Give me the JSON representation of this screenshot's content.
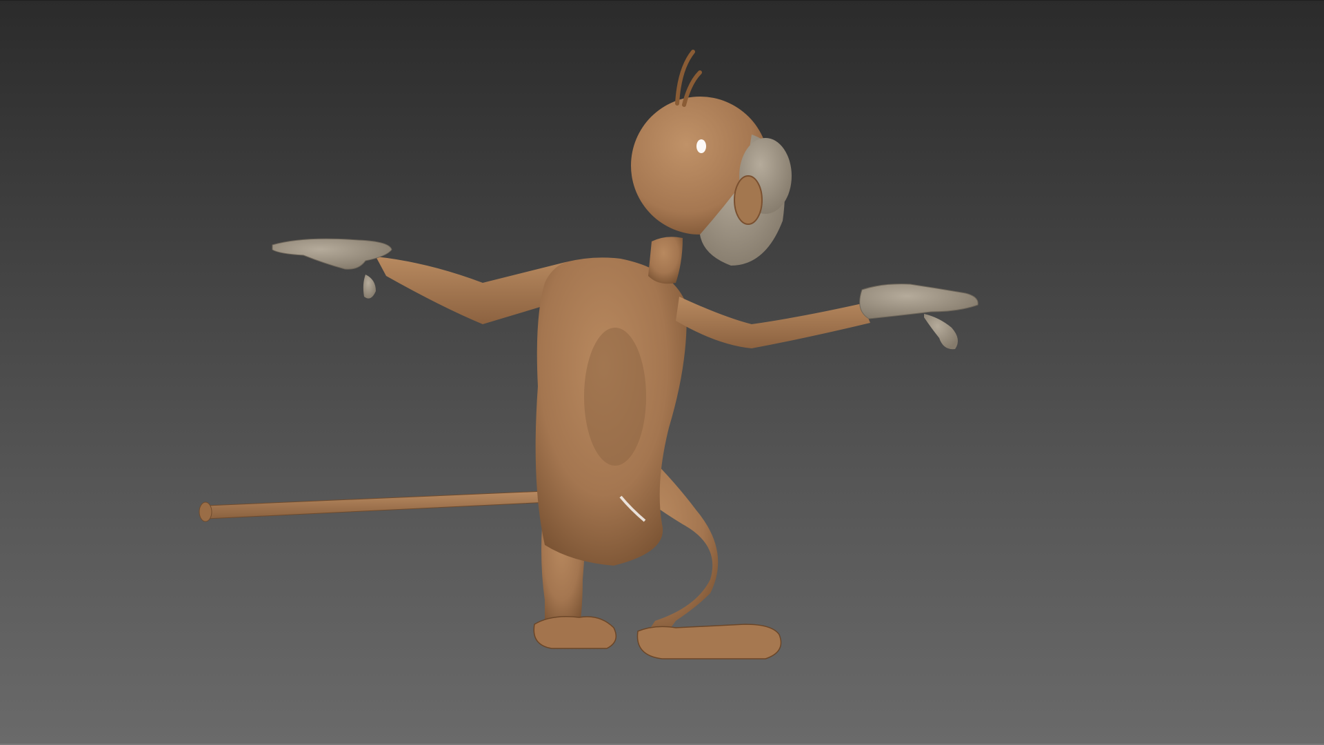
{
  "viewport": {
    "view_mode": "perspective",
    "shading": "shaded-glossy",
    "background": {
      "top_color": "#2b2b2b",
      "bottom_color": "#6a6a6a"
    }
  },
  "model": {
    "subject": "cartoon-monkey",
    "pose": "side-walking-arms-out",
    "colors": {
      "body": "#a87b55",
      "body_shadow": "#7d5636",
      "skin_light": "#9f9483",
      "face": "#a59a88",
      "tail": "#9c7049",
      "hair": "#8a5c35",
      "specular": "#ffffff"
    }
  }
}
